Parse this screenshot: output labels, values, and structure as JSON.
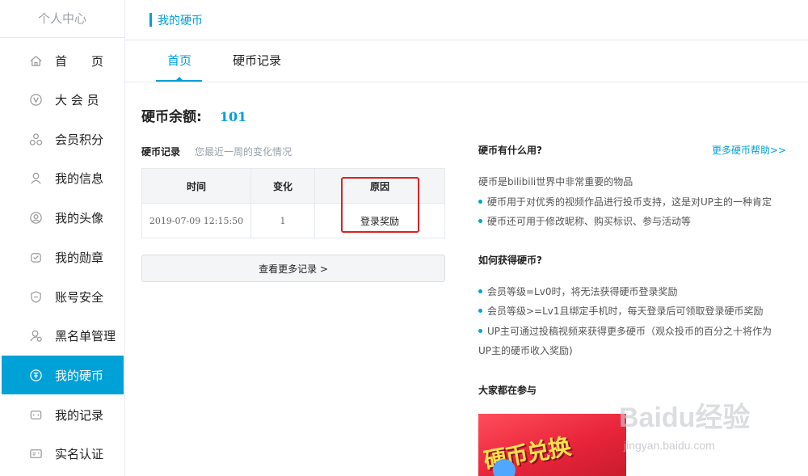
{
  "sidebar": {
    "title": "个人中心",
    "items": [
      {
        "label": "首　　页",
        "icon": "home-icon"
      },
      {
        "label": "大 会 员",
        "icon": "vip-icon"
      },
      {
        "label": "会员积分",
        "icon": "points-icon"
      },
      {
        "label": "我的信息",
        "icon": "user-icon"
      },
      {
        "label": "我的头像",
        "icon": "avatar-icon"
      },
      {
        "label": "我的勋章",
        "icon": "medal-icon"
      },
      {
        "label": "账号安全",
        "icon": "shield-icon"
      },
      {
        "label": "黑名单管理",
        "icon": "blacklist-icon"
      },
      {
        "label": "我的硬币",
        "icon": "coin-icon",
        "active": true
      },
      {
        "label": "我的记录",
        "icon": "record-icon"
      },
      {
        "label": "实名认证",
        "icon": "id-card-icon"
      }
    ]
  },
  "header": {
    "title": "我的硬币"
  },
  "tabs": [
    {
      "label": "首页",
      "active": true
    },
    {
      "label": "硬币记录",
      "active": false
    }
  ],
  "balance": {
    "label": "硬币余额:",
    "value": "101"
  },
  "records": {
    "title": "硬币记录",
    "subtitle": "您最近一周的变化情况",
    "columns": [
      "时间",
      "变化",
      "原因"
    ],
    "rows": [
      [
        "2019-07-09 12:15:50",
        "1",
        "登录奖励"
      ]
    ],
    "more_button": "查看更多记录 >"
  },
  "help": {
    "q1_title": "硬币有什么用?",
    "more_link": "更多硬币帮助>>",
    "q1_intro": "硬币是bilibili世界中非常重要的物品",
    "q1_points": [
      "硬币用于对优秀的视频作品进行投币支持，这是对UP主的一种肯定",
      "硬币还可用于修改昵称、购买标识、参与活动等"
    ],
    "q2_title": "如何获得硬币?",
    "q2_points": [
      "会员等级=Lv0时，将无法获得硬币登录奖励",
      "会员等级>=Lv1且绑定手机时，每天登录后可领取登录硬币奖励",
      "UP主可通过投稿视频来获得更多硬币（观众投币的百分之十将作为UP主的硬币收入奖励)"
    ],
    "activity_title": "大家都在参与",
    "promo_text": "硬币兑换"
  },
  "watermark": {
    "brand": "Baidu经验",
    "url": "jingyan.baidu.com"
  },
  "colors": {
    "accent": "#00a1d6",
    "highlight_box": "#e02020"
  }
}
